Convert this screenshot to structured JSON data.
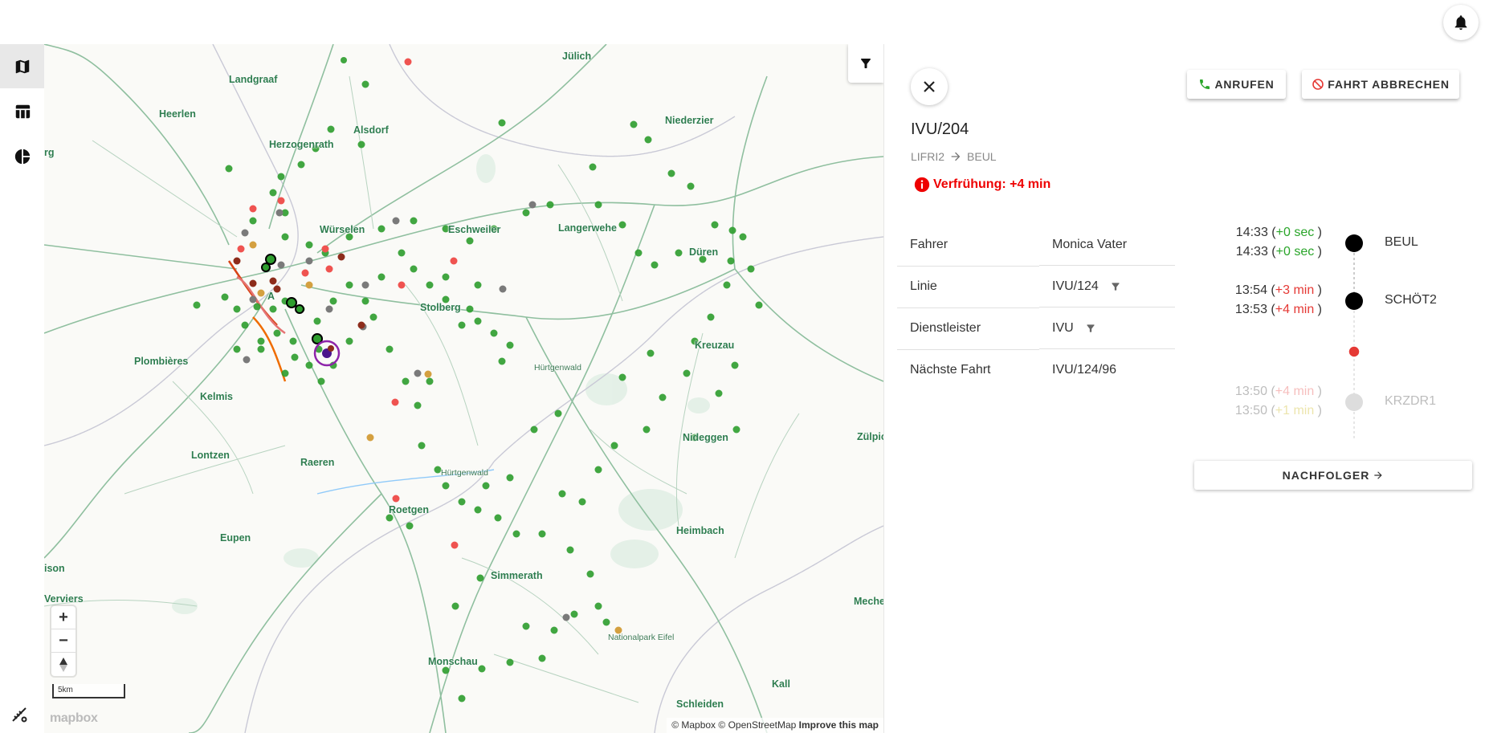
{
  "map": {
    "attribution_mapbox": "© Mapbox",
    "attribution_osm": "© OpenStreetMap",
    "attribution_improve": "Improve this map",
    "scale_label": "5km",
    "logo_text": "mapbox",
    "zoom_in": "+",
    "zoom_out": "−",
    "places": {
      "juelich": "Jülich",
      "landgraaf": "Landgraaf",
      "niederzier": "Niederzier",
      "heerlen": "Heerlen",
      "alsdorf": "Alsdorf",
      "herzogenrath": "Herzogenrath",
      "eschweiler": "Eschweiler",
      "langerwehe": "Langerwehe",
      "wuerselen": "Würselen",
      "dueren": "Düren",
      "stolberg": "Stolberg",
      "kreuzau": "Kreuzau",
      "aachen": "A",
      "plombieres": "Plombières",
      "huertgenwald1": "Hürtgenwald",
      "kelmis": "Kelmis",
      "nideggen": "Nideggen",
      "zuelpich": "Zülpic",
      "lontzen": "Lontzen",
      "raeren": "Raeren",
      "huertgenwald2": "Hürtgenwald",
      "roetgen": "Roetgen",
      "eupen": "Eupen",
      "heimbach": "Heimbach",
      "limbourg": "ison",
      "verviers": "Verviers",
      "simmerath": "Simmerath",
      "mechernich": "Meche",
      "nationalpark": "Nationalpark Eifel",
      "monschau": "Monschau",
      "kall": "Kall",
      "schleiden": "Schleiden",
      "left_edge": "rg"
    }
  },
  "panel": {
    "call_label": "ANRUFEN",
    "cancel_label": "FAHRT ABBRECHEN",
    "trip_id": "IVU/204",
    "route_from": "LIFRI2",
    "route_to": "BEUL",
    "alert_text": "Verfrühung: +4 min",
    "info": [
      {
        "key": "Fahrer",
        "value": "Monica Vater"
      },
      {
        "key": "Linie",
        "value": "IVU/124"
      },
      {
        "key": "Dienstleister",
        "value": "IVU"
      },
      {
        "key": "Nächste Fahrt",
        "value": "IVU/124/96"
      }
    ],
    "stops": [
      {
        "name": "BEUL",
        "arr_time": "14:33",
        "arr_delay": "+0 sec",
        "dep_time": "14:33",
        "dep_delay": "+0 sec"
      },
      {
        "name": "SCHÖT2",
        "arr_time": "13:54",
        "arr_delay": "+3 min",
        "dep_time": "13:53",
        "dep_delay": "+4 min"
      },
      {
        "name": "KRZDR1",
        "arr_time": "13:50",
        "arr_delay": "+4 min",
        "dep_time": "13:50",
        "dep_delay": "+1 min"
      }
    ],
    "paren_open": "(",
    "paren_close": ")",
    "next_label": "NACHFOLGER"
  },
  "colors": {
    "on_time": "#2aa52a",
    "late": "#e53935",
    "vehicle_green": "#2e9e2e",
    "vehicle_red": "#ef5350",
    "vehicle_orange": "#d4a040",
    "vehicle_gray": "#757575",
    "selected": "#8e24aa"
  }
}
